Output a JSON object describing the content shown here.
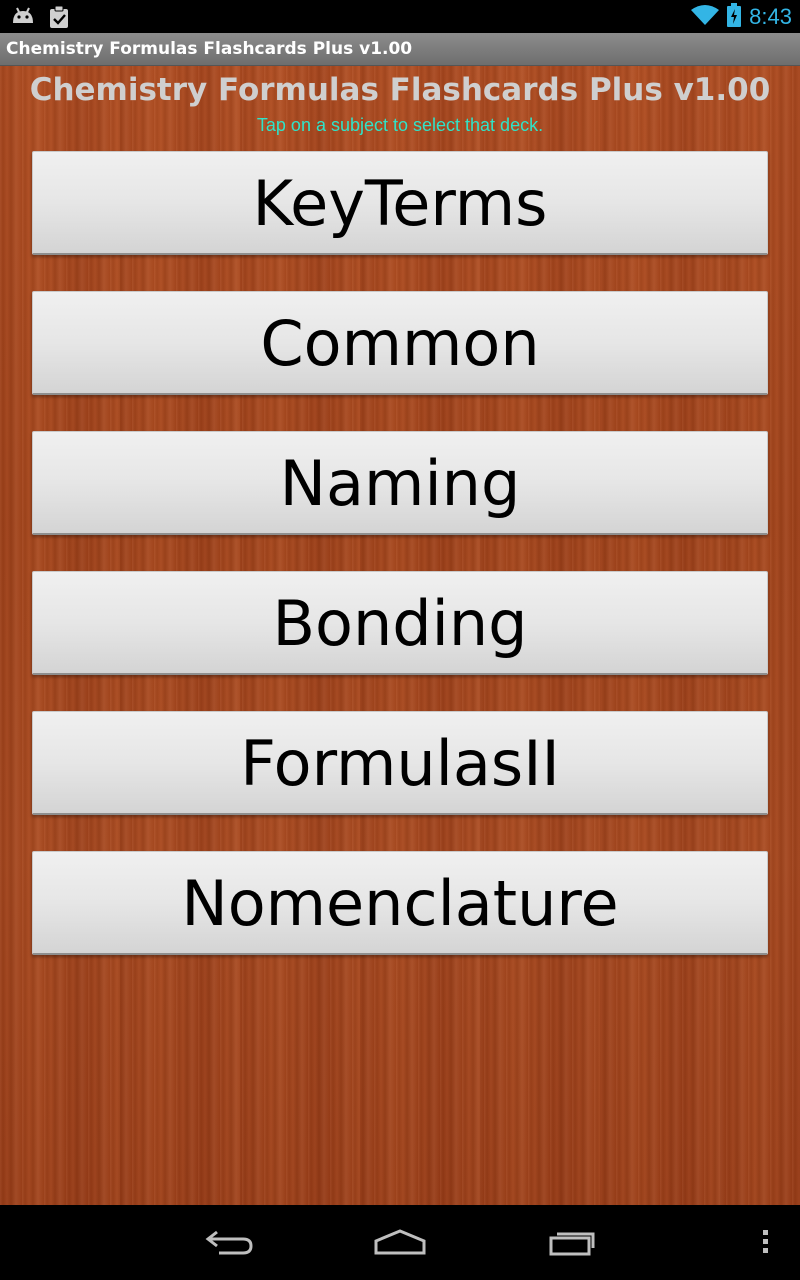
{
  "status_bar": {
    "left_icons": [
      "android-debug-icon",
      "clipboard-check-icon"
    ],
    "right_icons": [
      "wifi-icon",
      "battery-charging-icon"
    ],
    "clock": "8:43",
    "accent_color": "#33b5e5"
  },
  "title_bar": {
    "title": "Chemistry Formulas Flashcards Plus v1.00"
  },
  "main": {
    "title": "Chemistry Formulas Flashcards Plus v1.00",
    "subtitle": "Tap on a subject to select that deck.",
    "decks": [
      {
        "label": "KeyTerms"
      },
      {
        "label": "Common"
      },
      {
        "label": "Naming"
      },
      {
        "label": "Bonding"
      },
      {
        "label": "FormulasII"
      },
      {
        "label": "Nomenclature"
      }
    ]
  },
  "nav_bar": {
    "icons": [
      "back-icon",
      "home-icon",
      "recent-apps-icon",
      "overflow-menu-icon"
    ]
  }
}
